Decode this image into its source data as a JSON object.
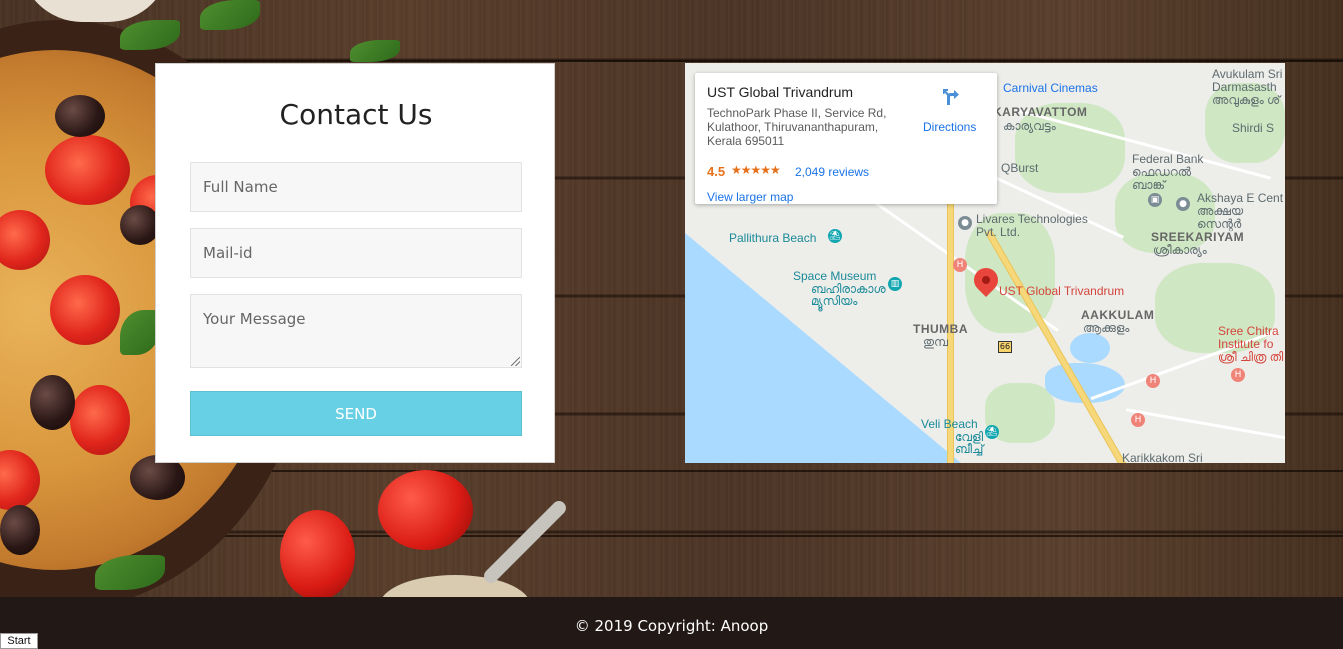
{
  "contact": {
    "title": "Contact Us",
    "name_placeholder": "Full Name",
    "mail_placeholder": "Mail-id",
    "message_placeholder": "Your Message",
    "send_label": "SEND"
  },
  "map": {
    "place_name": "UST Global Trivandrum",
    "address": "TechnoPark Phase II, Service Rd, Kulathoor, Thiruvananthapuram, Kerala 695011",
    "rating": "4.5",
    "stars": "★★★★★",
    "reviews": "2,049 reviews",
    "larger_map": "View larger map",
    "directions": "Directions",
    "labels": {
      "carnival": "Carnival Cinemas",
      "karyavattom": "KARYAVATTOM",
      "karyavattom_ml": "കാര്യവട്ടം",
      "avukulam": "Avukulam Sri",
      "darmasastha": "Darmasasth",
      "avukulam_ml": "അവുകുളം ശ്",
      "shirdi": "Shirdi S",
      "qburst": "QBurst",
      "federal": "Federal Bank",
      "federal_ml1": "ഫെഡറൽ",
      "federal_ml2": "ബാങ്ക്",
      "akshaya": "Akshaya E Cent",
      "akshaya_ml1": "അക്ഷയ",
      "akshaya_ml2": "സെന്റർ",
      "livares1": "Livares Technologies",
      "livares2": "Pvt. Ltd.",
      "sreekariyam": "SREEKARIYAM",
      "sreekariyam_ml": "ശ്രീകാര്യം",
      "pallithura": "Pallithura Beach",
      "space1": "Space Museum",
      "space2": "ബഹിരാകാശ",
      "space3": "മ്യൂസിയം",
      "ust_pin": "UST Global Trivandrum",
      "thumba": "THUMBA",
      "thumba_ml": "തുമ്പ",
      "aakkulam": "AAKKULAM",
      "aakkulam_ml": "ആക്കുളം",
      "sree1": "Sree Chitra",
      "sree2": "Institute fo",
      "sree3": "ശ്രീ ചിത്ര തി",
      "highway": "66",
      "veli1": "Veli Beach",
      "veli2": "വേളി",
      "veli3": "ബീച്ച്",
      "karikkakom": "Karikkakom Sri"
    }
  },
  "footer": {
    "copyright": "© 2019 Copyright: Anoop"
  },
  "taskbar": {
    "start": "Start"
  }
}
